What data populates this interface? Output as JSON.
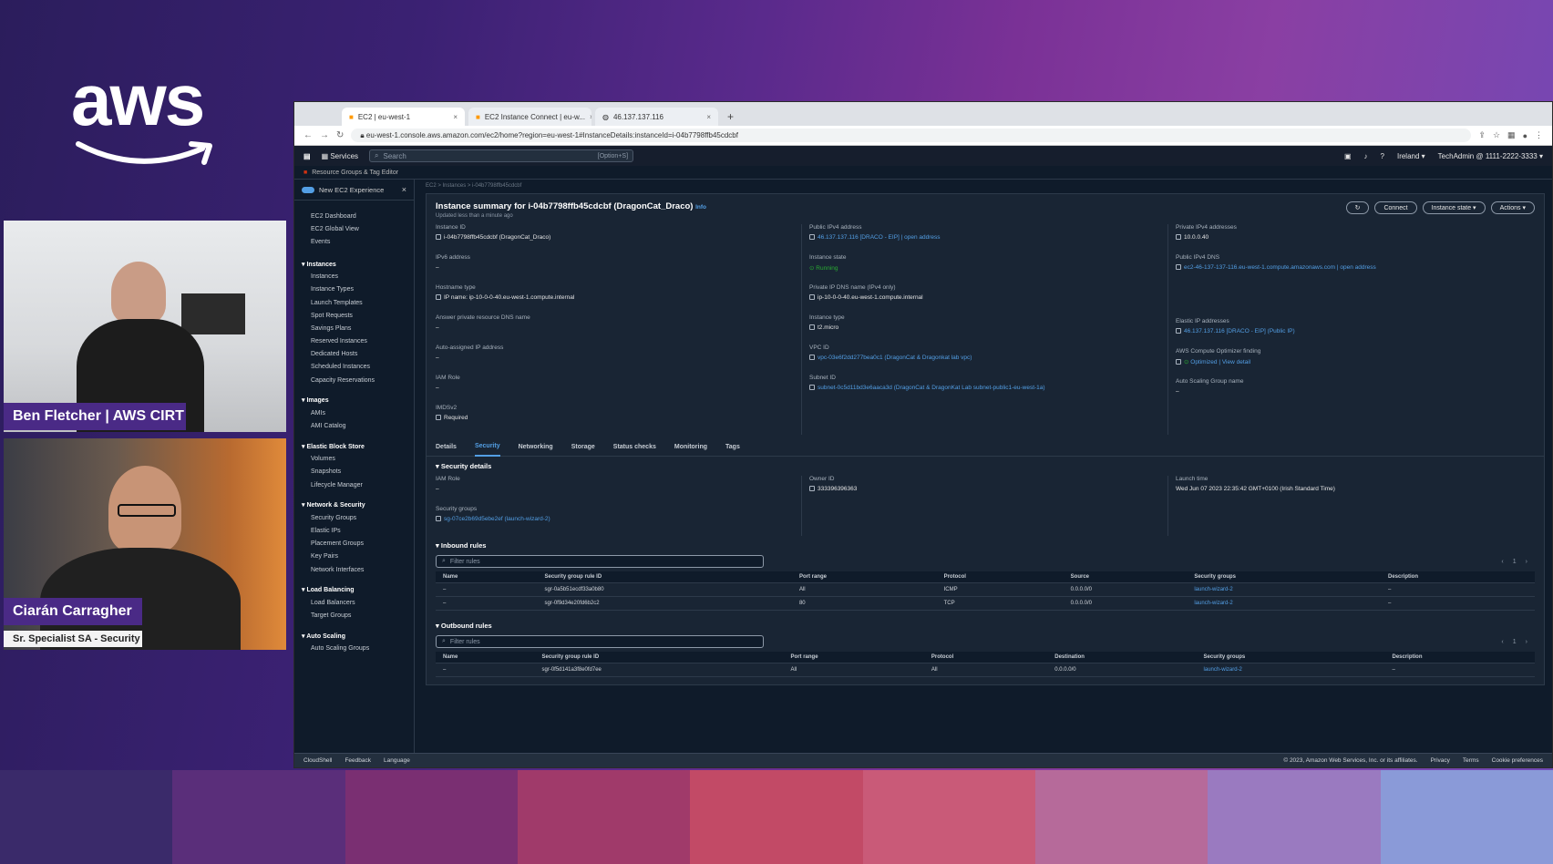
{
  "brand": {
    "logo_text": "aws"
  },
  "presenters": [
    {
      "name": "Ben Fletcher | AWS CIRT"
    },
    {
      "name": "Ciarán Carragher",
      "role": "Sr. Specialist SA - Security"
    }
  ],
  "browser": {
    "tabs": [
      {
        "label": "EC2 | eu-west-1"
      },
      {
        "label": "EC2 Instance Connect | eu-w..."
      },
      {
        "label": "46.137.137.116"
      }
    ],
    "url": "eu-west-1.console.aws.amazon.com/ec2/home?region=eu-west-1#InstanceDetails:instanceId=i-04b7798ffb45cdcbf"
  },
  "console_nav": {
    "services": "Services",
    "search_placeholder": "Search",
    "search_shortcut": "[Option+S]",
    "region": "Ireland ▾",
    "account": "TechAdmin @ 1111-2222-3333 ▾"
  },
  "favorites": {
    "label": "Resource Groups & Tag Editor"
  },
  "sidebar": {
    "new_experience": "New EC2 Experience",
    "top_items": [
      "EC2 Dashboard",
      "EC2 Global View",
      "Events"
    ],
    "sections": [
      {
        "title": "Instances",
        "items": [
          "Instances",
          "Instance Types",
          "Launch Templates",
          "Spot Requests",
          "Savings Plans",
          "Reserved Instances",
          "Dedicated Hosts",
          "Scheduled Instances",
          "Capacity Reservations"
        ]
      },
      {
        "title": "Images",
        "items": [
          "AMIs",
          "AMI Catalog"
        ]
      },
      {
        "title": "Elastic Block Store",
        "items": [
          "Volumes",
          "Snapshots",
          "Lifecycle Manager"
        ]
      },
      {
        "title": "Network & Security",
        "items": [
          "Security Groups",
          "Elastic IPs",
          "Placement Groups",
          "Key Pairs",
          "Network Interfaces"
        ]
      },
      {
        "title": "Load Balancing",
        "items": [
          "Load Balancers",
          "Target Groups"
        ]
      },
      {
        "title": "Auto Scaling",
        "items": [
          "Auto Scaling Groups"
        ]
      }
    ]
  },
  "summary": {
    "breadcrumb": "EC2 > Instances > i-04b7798ffb45cdcbf",
    "title": "Instance summary for i-04b7798ffb45cdcbf (DragonCat_Draco)",
    "info": "Info",
    "updated": "Updated less than a minute ago",
    "buttons": {
      "refresh": "↻",
      "connect": "Connect",
      "instance_state": "Instance state ▾",
      "actions": "Actions ▾"
    },
    "col1": [
      {
        "label": "Instance ID",
        "value": "i-04b7798ffb45cdcbf (DragonCat_Draco)"
      },
      {
        "label": "IPv6 address",
        "value": "–"
      },
      {
        "label": "Hostname type",
        "value": "IP name: ip-10-0-0-40.eu-west-1.compute.internal"
      },
      {
        "label": "Answer private resource DNS name",
        "value": "–"
      },
      {
        "label": "Auto-assigned IP address",
        "value": "–"
      },
      {
        "label": "IAM Role",
        "value": "–"
      },
      {
        "label": "IMDSv2",
        "value": "Required"
      }
    ],
    "col2": [
      {
        "label": "Public IPv4 address",
        "value": "46.137.137.116 [DRACO - EIP] | open address"
      },
      {
        "label": "Instance state",
        "value": "Running"
      },
      {
        "label": "Private IP DNS name (IPv4 only)",
        "value": "ip-10-0-0-40.eu-west-1.compute.internal"
      },
      {
        "label": "Instance type",
        "value": "t2.micro"
      },
      {
        "label": "VPC ID",
        "value": "vpc-03e6f2dd277bea0c1 (DragonCat & Dragonkat lab vpc)"
      },
      {
        "label": "Subnet ID",
        "value": "subnet-0c5d11bd3e6aaca3d (DragonCat & DragonKat Lab subnet-public1-eu-west-1a)"
      }
    ],
    "col3": [
      {
        "label": "Private IPv4 addresses",
        "value": "10.0.0.40"
      },
      {
        "label": "Public IPv4 DNS",
        "value": "ec2-46-137-137-116.eu-west-1.compute.amazonaws.com | open address"
      },
      {
        "label": "",
        "value": ""
      },
      {
        "label": "Elastic IP addresses",
        "value": "46.137.137.116 [DRACO - EIP] (Public IP)"
      },
      {
        "label": "AWS Compute Optimizer finding",
        "value": "Optimized | View detail"
      },
      {
        "label": "Auto Scaling Group name",
        "value": "–"
      }
    ]
  },
  "detail_tabs": [
    "Details",
    "Security",
    "Networking",
    "Storage",
    "Status checks",
    "Monitoring",
    "Tags"
  ],
  "security": {
    "title": "Security details",
    "iam_label": "IAM Role",
    "iam_value": "–",
    "owner_label": "Owner ID",
    "owner_value": "333396396363",
    "launch_label": "Launch time",
    "launch_value": "Wed Jun 07 2023 22:35:42 GMT+0100 (Irish Standard Time)",
    "sg_label": "Security groups",
    "sg_value": "sg-07ce2b69d5ebe2ef (launch-wizard-2)"
  },
  "inbound": {
    "title": "Inbound rules",
    "filter_placeholder": "Filter rules",
    "page": "1",
    "headers": [
      "Name",
      "Security group rule ID",
      "Port range",
      "Protocol",
      "Source",
      "Security groups",
      "Description"
    ],
    "rows": [
      [
        "–",
        "sgr-0a5b51ecdf33a0b80",
        "All",
        "ICMP",
        "0.0.0.0/0",
        "launch-wizard-2",
        "–"
      ],
      [
        "–",
        "sgr-0f9d34e20fd6b2c2",
        "80",
        "TCP",
        "0.0.0.0/0",
        "launch-wizard-2",
        "–"
      ]
    ]
  },
  "outbound": {
    "title": "Outbound rules",
    "filter_placeholder": "Filter rules",
    "page": "1",
    "headers": [
      "Name",
      "Security group rule ID",
      "Port range",
      "Protocol",
      "Destination",
      "Security groups",
      "Description"
    ],
    "rows": [
      [
        "–",
        "sgr-0f5d141a3f8e0fd7ee",
        "All",
        "All",
        "0.0.0.0/0",
        "launch-wizard-2",
        "–"
      ]
    ]
  },
  "footer": {
    "left": [
      "CloudShell",
      "Feedback",
      "Language"
    ],
    "copyright": "© 2023, Amazon Web Services, Inc. or its affiliates.",
    "right": [
      "Privacy",
      "Terms",
      "Cookie preferences"
    ]
  },
  "colors": {
    "accent": "#539fe5",
    "success": "#29ad32",
    "bg": "#0f1b2a",
    "panel": "#192534"
  }
}
